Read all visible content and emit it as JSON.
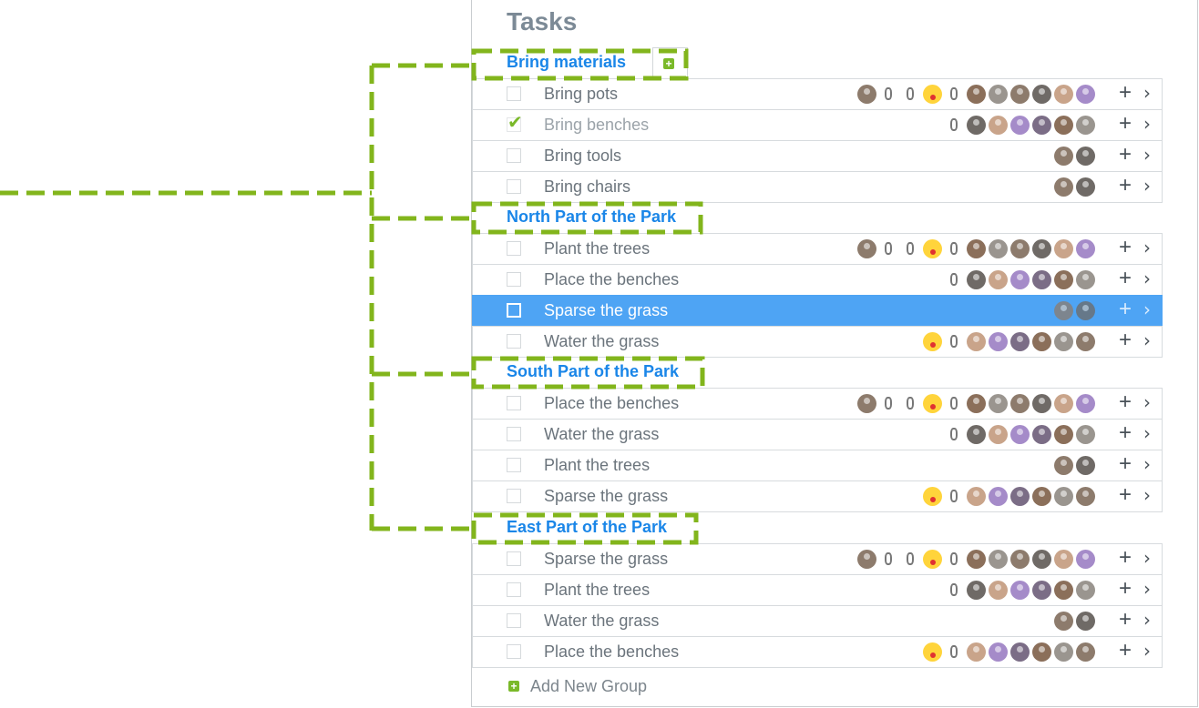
{
  "title": "Tasks",
  "add_group_label": "Add New Group",
  "colors": {
    "group": "#1a86e8",
    "accent": "#7ab929",
    "selection": "#4ea4f4",
    "connector": "#82b51c"
  },
  "groups": [
    {
      "name": "Bring materials",
      "has_add_button": true,
      "tasks": [
        {
          "name": "Bring pots",
          "done": false,
          "avatars": [
            "photo",
            "sketch",
            "sketch",
            "emoji",
            "sketch",
            "photo",
            "photo",
            "photo",
            "photo",
            "photo",
            "photo"
          ]
        },
        {
          "name": "Bring benches",
          "done": true,
          "avatars": [
            "sketch",
            "photo",
            "photo",
            "photo",
            "photo",
            "photo",
            "photo"
          ]
        },
        {
          "name": "Bring tools",
          "done": false,
          "avatars": [
            "photo",
            "photo"
          ]
        },
        {
          "name": "Bring chairs",
          "done": false,
          "avatars": [
            "photo",
            "photo"
          ]
        }
      ]
    },
    {
      "name": "North Part of the Park",
      "tasks": [
        {
          "name": "Plant the trees",
          "done": false,
          "avatars": [
            "photo",
            "sketch",
            "sketch",
            "emoji",
            "sketch",
            "photo",
            "photo",
            "photo",
            "photo",
            "photo",
            "photo"
          ]
        },
        {
          "name": "Place the benches",
          "done": false,
          "avatars": [
            "sketch",
            "photo",
            "photo",
            "photo",
            "photo",
            "photo",
            "photo"
          ]
        },
        {
          "name": "Sparse the grass",
          "done": false,
          "selected": true,
          "avatars": [
            "photo",
            "photo"
          ]
        },
        {
          "name": "Water the grass",
          "done": false,
          "avatars": [
            "emoji",
            "sketch",
            "photo",
            "photo",
            "photo",
            "photo",
            "photo",
            "photo"
          ]
        }
      ]
    },
    {
      "name": "South Part of the Park",
      "tasks": [
        {
          "name": "Place the benches",
          "done": false,
          "avatars": [
            "photo",
            "sketch",
            "sketch",
            "emoji",
            "sketch",
            "photo",
            "photo",
            "photo",
            "photo",
            "photo",
            "photo"
          ]
        },
        {
          "name": "Water the grass",
          "done": false,
          "avatars": [
            "sketch",
            "photo",
            "photo",
            "photo",
            "photo",
            "photo",
            "photo"
          ]
        },
        {
          "name": "Plant the trees",
          "done": false,
          "avatars": [
            "photo",
            "photo"
          ]
        },
        {
          "name": "Sparse the grass",
          "done": false,
          "avatars": [
            "emoji",
            "sketch",
            "photo",
            "photo",
            "photo",
            "photo",
            "photo",
            "photo"
          ]
        }
      ]
    },
    {
      "name": "East Part of the Park",
      "tasks": [
        {
          "name": "Sparse the grass",
          "done": false,
          "avatars": [
            "photo",
            "sketch",
            "sketch",
            "emoji",
            "sketch",
            "photo",
            "photo",
            "photo",
            "photo",
            "photo",
            "photo"
          ]
        },
        {
          "name": "Plant the trees",
          "done": false,
          "avatars": [
            "sketch",
            "photo",
            "photo",
            "photo",
            "photo",
            "photo",
            "photo"
          ]
        },
        {
          "name": "Water the grass",
          "done": false,
          "avatars": [
            "photo",
            "photo"
          ]
        },
        {
          "name": "Place the benches",
          "done": false,
          "avatars": [
            "emoji",
            "sketch",
            "photo",
            "photo",
            "photo",
            "photo",
            "photo",
            "photo"
          ]
        }
      ]
    }
  ]
}
